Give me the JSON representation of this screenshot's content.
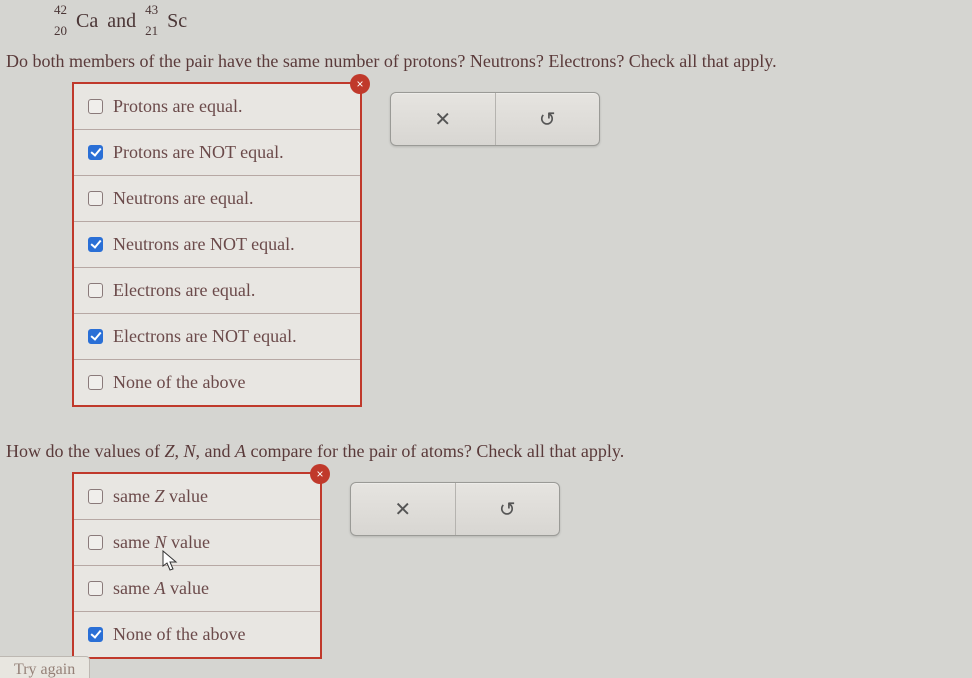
{
  "nuclides": {
    "a": {
      "mass": "42",
      "atomic": "20",
      "symbol": "Ca"
    },
    "and": "and",
    "b": {
      "mass": "43",
      "atomic": "21",
      "symbol": "Sc"
    }
  },
  "q1": {
    "text": "Do both members of the pair have the same number of protons? Neutrons? Electrons? Check all that apply.",
    "options": [
      {
        "label": "Protons are equal.",
        "checked": false
      },
      {
        "label": "Protons are NOT equal.",
        "checked": true
      },
      {
        "label": "Neutrons are equal.",
        "checked": false
      },
      {
        "label": "Neutrons are NOT equal.",
        "checked": true
      },
      {
        "label": "Electrons are equal.",
        "checked": false
      },
      {
        "label": "Electrons are NOT equal.",
        "checked": true
      },
      {
        "label": "None of the above",
        "checked": false
      }
    ],
    "badge": "×"
  },
  "q2": {
    "prefix": "How do the values of ",
    "z": "Z",
    "comma1": ", ",
    "n": "N",
    "comma2": ", and ",
    "a": "A",
    "suffix": " compare for the pair of atoms? Check all that apply.",
    "options": [
      {
        "prefix": "same ",
        "var": "Z",
        "suffix": " value",
        "checked": false
      },
      {
        "prefix": "same ",
        "var": "N",
        "suffix": " value",
        "checked": false
      },
      {
        "prefix": "same ",
        "var": "A",
        "suffix": " value",
        "checked": false
      },
      {
        "prefix": "None of the above",
        "var": "",
        "suffix": "",
        "checked": true
      }
    ],
    "badge": "×"
  },
  "toolbar": {
    "close": "✕",
    "reset": "↺"
  },
  "tryAgain": "Try again"
}
